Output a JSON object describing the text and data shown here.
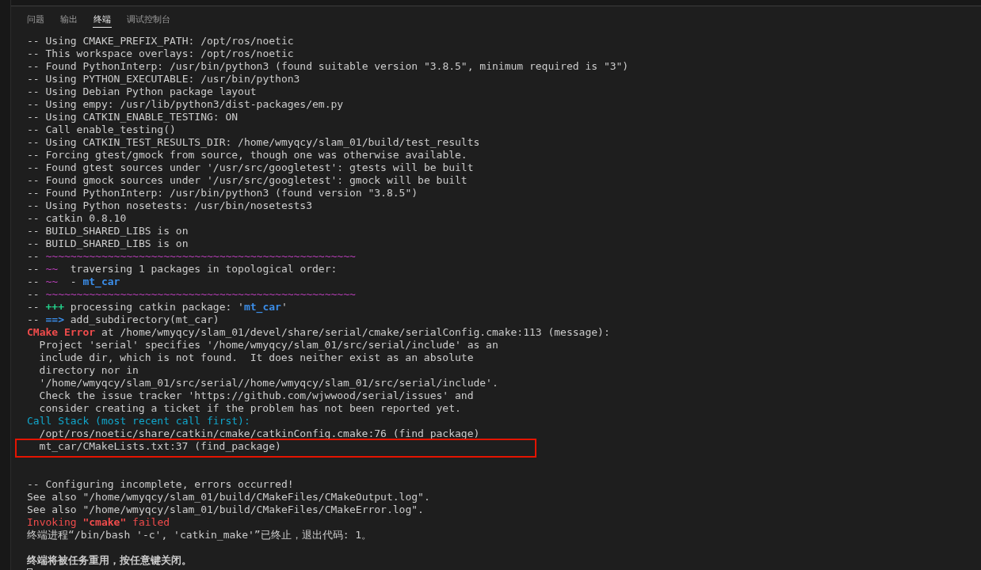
{
  "tabs": [
    {
      "label": "问题",
      "selected": false
    },
    {
      "label": "输出",
      "selected": false
    },
    {
      "label": "终端",
      "selected": true
    },
    {
      "label": "调试控制台",
      "selected": false
    }
  ],
  "terminal": {
    "lines": [
      {
        "kind": "plain",
        "segments": [
          {
            "kind": "normal",
            "text": "-- Using CMAKE_PREFIX_PATH: /opt/ros/noetic"
          }
        ]
      },
      {
        "kind": "plain",
        "segments": [
          {
            "kind": "normal",
            "text": "-- This workspace overlays: /opt/ros/noetic"
          }
        ]
      },
      {
        "kind": "plain",
        "segments": [
          {
            "kind": "normal",
            "text": "-- Found PythonInterp: /usr/bin/python3 (found suitable version \"3.8.5\", minimum required is \"3\")"
          }
        ]
      },
      {
        "kind": "plain",
        "segments": [
          {
            "kind": "normal",
            "text": "-- Using PYTHON_EXECUTABLE: /usr/bin/python3"
          }
        ]
      },
      {
        "kind": "plain",
        "segments": [
          {
            "kind": "normal",
            "text": "-- Using Debian Python package layout"
          }
        ]
      },
      {
        "kind": "plain",
        "segments": [
          {
            "kind": "normal",
            "text": "-- Using empy: /usr/lib/python3/dist-packages/em.py"
          }
        ]
      },
      {
        "kind": "plain",
        "segments": [
          {
            "kind": "normal",
            "text": "-- Using CATKIN_ENABLE_TESTING: ON"
          }
        ]
      },
      {
        "kind": "plain",
        "segments": [
          {
            "kind": "normal",
            "text": "-- Call enable_testing()"
          }
        ]
      },
      {
        "kind": "plain",
        "segments": [
          {
            "kind": "normal",
            "text": "-- Using CATKIN_TEST_RESULTS_DIR: /home/wmyqcy/slam_01/build/test_results"
          }
        ]
      },
      {
        "kind": "plain",
        "segments": [
          {
            "kind": "normal",
            "text": "-- Forcing gtest/gmock from source, though one was otherwise available."
          }
        ]
      },
      {
        "kind": "plain",
        "segments": [
          {
            "kind": "normal",
            "text": "-- Found gtest sources under '/usr/src/googletest': gtests will be built"
          }
        ]
      },
      {
        "kind": "plain",
        "segments": [
          {
            "kind": "normal",
            "text": "-- Found gmock sources under '/usr/src/googletest': gmock will be built"
          }
        ]
      },
      {
        "kind": "plain",
        "segments": [
          {
            "kind": "normal",
            "text": "-- Found PythonInterp: /usr/bin/python3 (found version \"3.8.5\")"
          }
        ]
      },
      {
        "kind": "plain",
        "segments": [
          {
            "kind": "normal",
            "text": "-- Using Python nosetests: /usr/bin/nosetests3"
          }
        ]
      },
      {
        "kind": "plain",
        "segments": [
          {
            "kind": "normal",
            "text": "-- catkin 0.8.10"
          }
        ]
      },
      {
        "kind": "plain",
        "segments": [
          {
            "kind": "normal",
            "text": "-- BUILD_SHARED_LIBS is on"
          }
        ]
      },
      {
        "kind": "plain",
        "segments": [
          {
            "kind": "normal",
            "text": "-- BUILD_SHARED_LIBS is on"
          }
        ]
      },
      {
        "kind": "plain",
        "segments": [
          {
            "kind": "normal",
            "text": "-- "
          },
          {
            "kind": "magenta",
            "text": "~~~~~~~~~~~~~~~~~~~~~~~~~~~~~~~~~~~~~~~~~~~~~~~~~~"
          }
        ]
      },
      {
        "kind": "plain",
        "segments": [
          {
            "kind": "normal",
            "text": "-- "
          },
          {
            "kind": "magenta",
            "text": "~~"
          },
          {
            "kind": "normal",
            "text": "  traversing 1 packages in topological order:"
          }
        ]
      },
      {
        "kind": "plain",
        "segments": [
          {
            "kind": "normal",
            "text": "-- "
          },
          {
            "kind": "magenta",
            "text": "~~"
          },
          {
            "kind": "normal",
            "text": "  - "
          },
          {
            "kind": "blue-bold",
            "text": "mt_car"
          }
        ]
      },
      {
        "kind": "plain",
        "segments": [
          {
            "kind": "normal",
            "text": "-- "
          },
          {
            "kind": "magenta",
            "text": "~~~~~~~~~~~~~~~~~~~~~~~~~~~~~~~~~~~~~~~~~~~~~~~~~~"
          }
        ]
      },
      {
        "kind": "plain",
        "segments": [
          {
            "kind": "normal",
            "text": "-- "
          },
          {
            "kind": "green-bold",
            "text": "+++"
          },
          {
            "kind": "normal",
            "text": " processing catkin package: '"
          },
          {
            "kind": "blue-bold",
            "text": "mt_car"
          },
          {
            "kind": "normal",
            "text": "'"
          }
        ]
      },
      {
        "kind": "plain",
        "segments": [
          {
            "kind": "normal",
            "text": "-- "
          },
          {
            "kind": "blue-bold",
            "text": "==>"
          },
          {
            "kind": "normal",
            "text": " add_subdirectory(mt_car)"
          }
        ]
      },
      {
        "kind": "plain",
        "segments": [
          {
            "kind": "red-bold",
            "text": "CMake Error"
          },
          {
            "kind": "normal",
            "text": " at /home/wmyqcy/slam_01/devel/share/serial/cmake/serialConfig.cmake:113 (message):"
          }
        ]
      },
      {
        "kind": "indented",
        "segments": [
          {
            "kind": "normal",
            "text": "Project 'serial' specifies '/home/wmyqcy/slam_01/src/serial/include' as an"
          }
        ]
      },
      {
        "kind": "indented",
        "segments": [
          {
            "kind": "normal",
            "text": "include dir, which is not found.  It does neither exist as an absolute"
          }
        ]
      },
      {
        "kind": "indented",
        "segments": [
          {
            "kind": "normal",
            "text": "directory nor in"
          }
        ]
      },
      {
        "kind": "indented",
        "segments": [
          {
            "kind": "normal",
            "text": "'/home/wmyqcy/slam_01/src/serial//home/wmyqcy/slam_01/src/serial/include'."
          }
        ]
      },
      {
        "kind": "indented",
        "segments": [
          {
            "kind": "normal",
            "text": "Check the issue tracker 'https://github.com/wjwwood/serial/issues' and"
          }
        ]
      },
      {
        "kind": "indented",
        "segments": [
          {
            "kind": "normal",
            "text": "consider creating a ticket if the problem has not been reported yet."
          }
        ]
      },
      {
        "kind": "plain",
        "segments": [
          {
            "kind": "cyan",
            "text": "Call Stack (most recent call first):"
          }
        ]
      },
      {
        "kind": "indented",
        "segments": [
          {
            "kind": "normal",
            "text": "/opt/ros/noetic/share/catkin/cmake/catkinConfig.cmake:76 (find_package)"
          }
        ]
      },
      {
        "kind": "highlighted",
        "segments": [
          {
            "kind": "normal",
            "text": "mt_car/CMakeLists.txt:37 (find_package)"
          }
        ]
      },
      {
        "kind": "blank"
      },
      {
        "kind": "blank"
      },
      {
        "kind": "plain",
        "segments": [
          {
            "kind": "normal",
            "text": "-- Configuring incomplete, errors occurred!"
          }
        ]
      },
      {
        "kind": "plain",
        "segments": [
          {
            "kind": "normal",
            "text": "See also \"/home/wmyqcy/slam_01/build/CMakeFiles/CMakeOutput.log\"."
          }
        ]
      },
      {
        "kind": "plain",
        "segments": [
          {
            "kind": "normal",
            "text": "See also \"/home/wmyqcy/slam_01/build/CMakeFiles/CMakeError.log\"."
          }
        ]
      },
      {
        "kind": "plain",
        "segments": [
          {
            "kind": "red",
            "text": "Invoking "
          },
          {
            "kind": "red-bold",
            "text": "\"cmake\""
          },
          {
            "kind": "red",
            "text": " failed"
          }
        ]
      },
      {
        "kind": "plain",
        "segments": [
          {
            "kind": "normal",
            "text": "终端进程“/bin/bash '-c', 'catkin_make'”已终止，退出代码: 1。"
          }
        ]
      },
      {
        "kind": "blank"
      },
      {
        "kind": "bold",
        "segments": [
          {
            "kind": "normal",
            "text": "终端将被任务重用，按任意键关闭。"
          }
        ]
      },
      {
        "kind": "cursor"
      }
    ]
  }
}
